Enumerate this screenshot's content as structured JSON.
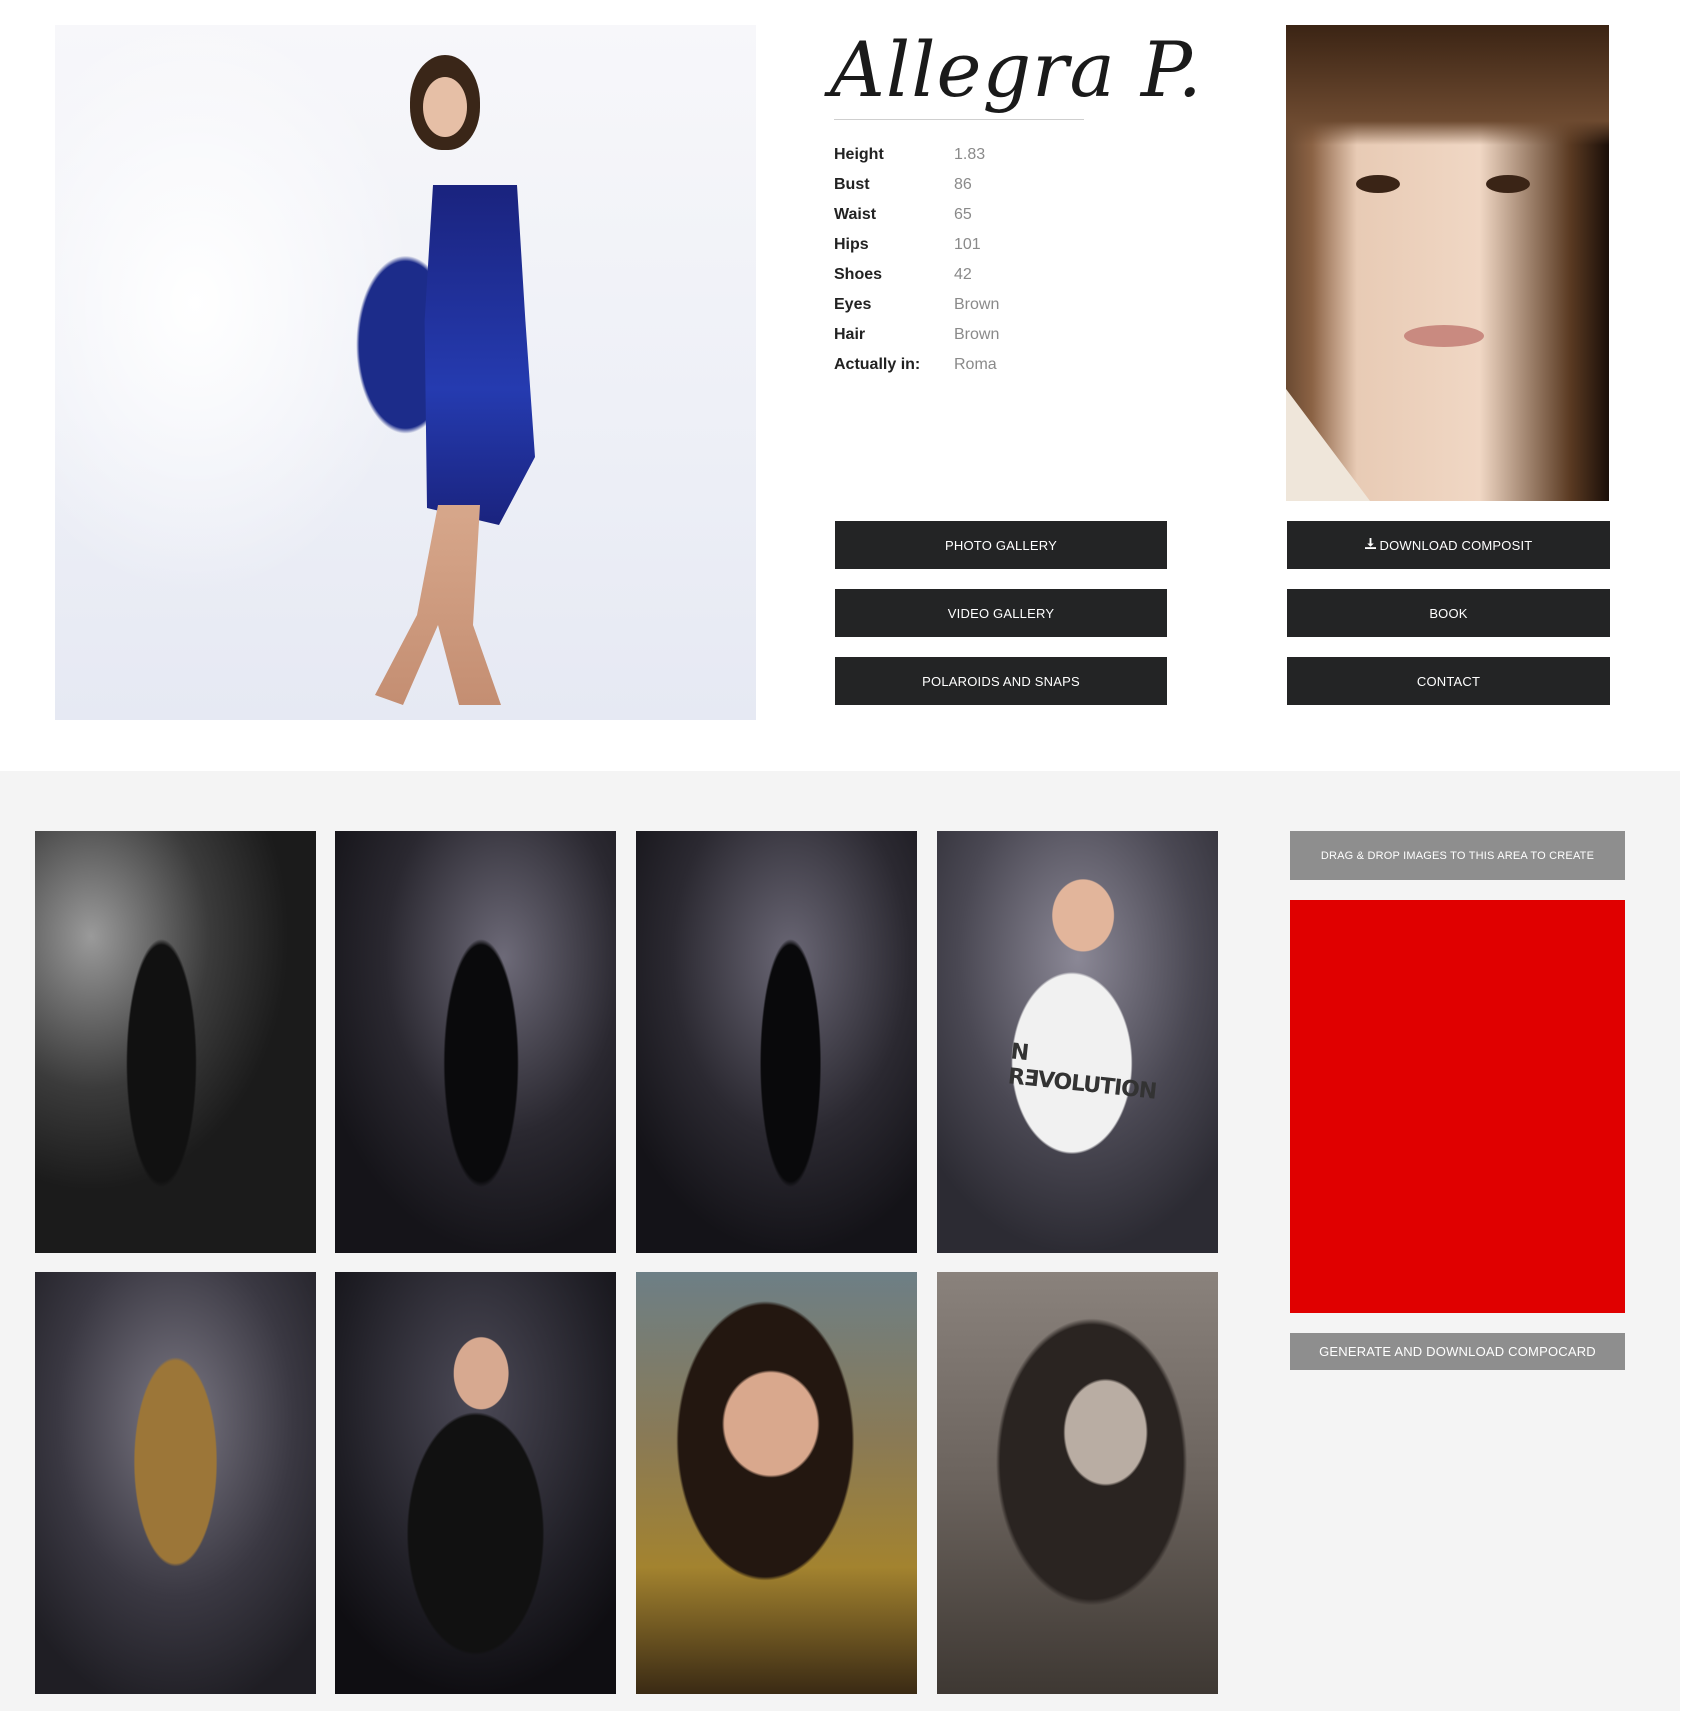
{
  "model": {
    "name": "Allegra P."
  },
  "stats": [
    {
      "label": "Height",
      "value": "1.83"
    },
    {
      "label": "Bust",
      "value": "86"
    },
    {
      "label": "Waist",
      "value": "65"
    },
    {
      "label": "Hips",
      "value": "101"
    },
    {
      "label": "Shoes",
      "value": "42"
    },
    {
      "label": "Eyes",
      "value": "Brown"
    },
    {
      "label": "Hair",
      "value": "Brown"
    },
    {
      "label": "Actually in:",
      "value": "Roma"
    }
  ],
  "buttons": {
    "photo_gallery": "PHOTO GALLERY",
    "video_gallery": "VIDEO GALLERY",
    "polaroids": "POLAROIDS AND SNAPS",
    "download_composit": "DOWNLOAD COMPOSIT",
    "book": "BOOK",
    "contact": "CONTACT"
  },
  "compocard": {
    "drag_text": "DRAG & DROP IMAGES TO THIS AREA TO CREATE",
    "generate_label": "GENERATE AND DOWNLOAD COMPOCARD",
    "drop_area_color": "#e00000"
  },
  "gallery": {
    "tee_print": "N RƎVOLUTION"
  },
  "colors": {
    "button_dark": "#232425",
    "button_grey": "#8e8e8e",
    "section_bg": "#f4f4f4"
  },
  "icons": {
    "download": "download-icon"
  }
}
